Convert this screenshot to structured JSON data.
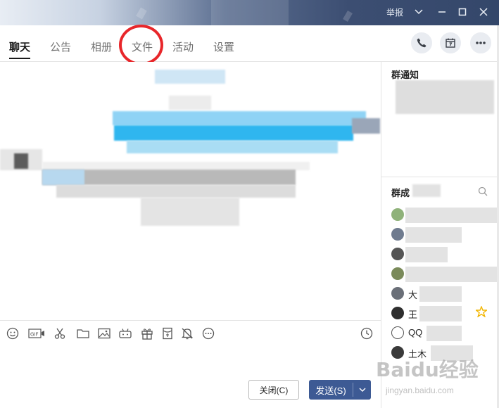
{
  "titlebar": {
    "report_label": "举报",
    "icons": [
      "chevron-down-icon",
      "minimize-icon",
      "maximize-icon",
      "close-icon"
    ]
  },
  "tabs": [
    {
      "label": "聊天",
      "active": true
    },
    {
      "label": "公告",
      "active": false
    },
    {
      "label": "相册",
      "active": false
    },
    {
      "label": "文件",
      "active": false
    },
    {
      "label": "活动",
      "active": false
    },
    {
      "label": "设置",
      "active": false
    }
  ],
  "header_actions": [
    "phone-icon",
    "calendar-icon",
    "more-icon"
  ],
  "right_panel": {
    "notice_title": "群通知",
    "members_title": "群成",
    "members": [
      {
        "name": ""
      },
      {
        "name": ""
      },
      {
        "name": ""
      },
      {
        "name": ""
      },
      {
        "name": "大"
      },
      {
        "name": "王"
      },
      {
        "name": "QQ"
      },
      {
        "name": "土木"
      }
    ]
  },
  "toolbar_icons": [
    "emoji-icon",
    "gif-icon",
    "screenshot-scissors-icon",
    "folder-icon",
    "image-icon",
    "game-icon",
    "gift-icon",
    "red-packet-icon",
    "mute-bell-icon",
    "more-circle-icon",
    "history-clock-icon"
  ],
  "buttons": {
    "close_label": "关闭(C)",
    "send_label": "发送(S)"
  },
  "watermark": {
    "brand": "Baidu经验",
    "url": "jingyan.baidu.com"
  },
  "colors": {
    "accent_send": "#3d5a94",
    "annotation_circle": "#e8262a"
  }
}
